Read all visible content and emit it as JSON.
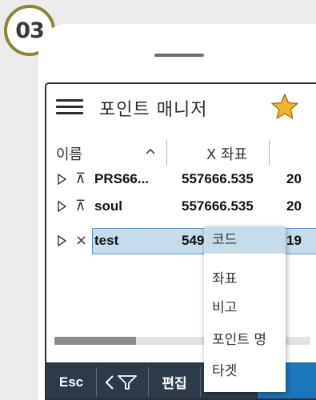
{
  "step": {
    "number": "03"
  },
  "header": {
    "title": "포인트 매니저",
    "menu_icon": "hamburger-icon",
    "favorite_icon": "star-icon",
    "star_color": "#f4b42a"
  },
  "columns": {
    "name": "이름",
    "x": "X 좌표",
    "sort": "ascending"
  },
  "rows": [
    {
      "type_icon": "⊼",
      "name": "PRS66...",
      "x": "557666.535",
      "y": "20"
    },
    {
      "type_icon": "⊼",
      "name": "soul",
      "x": "557666.535",
      "y": "20"
    },
    {
      "type_icon": "×",
      "name": "test",
      "x": "549",
      "y": "19",
      "selected": true
    }
  ],
  "bottom_bar": {
    "esc": "Esc",
    "filter_icon": "filter-icon",
    "edit": "편집",
    "btn4": "",
    "btn5": ""
  },
  "context_menu": {
    "items": [
      "코드",
      "좌표",
      "비고",
      "포인트 명",
      "타겟"
    ],
    "highlighted": 0
  },
  "colors": {
    "accent": "#1c76bb",
    "selection": "#c6dceb",
    "bar": "#2c3a4a",
    "badge_border": "#8b8634"
  }
}
